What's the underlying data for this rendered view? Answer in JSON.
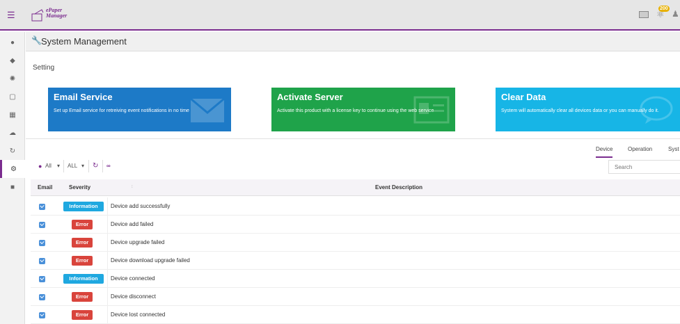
{
  "app": {
    "logo_line1": "ePaper",
    "logo_line2": "Manager",
    "notification_count": "200"
  },
  "header": {
    "title": "System Management"
  },
  "section_label": "Setting",
  "cards": [
    {
      "title": "Email Service",
      "desc": "Set up Email service for retreiving event notifications in no time",
      "color": "#1d7ac7"
    },
    {
      "title": "Activate Server",
      "desc": "Activate this product with a license key to continue using the web service",
      "color": "#1fa34a"
    },
    {
      "title": "Clear Data",
      "desc": "System will automatically clear all devices data or you can manually do it.",
      "color": "#17b5e6"
    }
  ],
  "tabs": [
    "Device",
    "Operation",
    "Syst"
  ],
  "toolbar": {
    "filter_all": "All",
    "filter_all2": "ALL"
  },
  "search": {
    "placeholder": "Search"
  },
  "table": {
    "columns": [
      "Email",
      "Severity",
      "Event Description"
    ],
    "rows": [
      {
        "severity": "Information",
        "desc": "Device add successfully"
      },
      {
        "severity": "Error",
        "desc": "Device add failed"
      },
      {
        "severity": "Error",
        "desc": "Device upgrade failed"
      },
      {
        "severity": "Error",
        "desc": "Device download upgrade failed"
      },
      {
        "severity": "Information",
        "desc": "Device connected"
      },
      {
        "severity": "Error",
        "desc": "Device disconnect"
      },
      {
        "severity": "Error",
        "desc": "Device lost connected"
      }
    ]
  },
  "colors": {
    "accent": "#7b2c8f",
    "info": "#1fa8e0",
    "error": "#d9443c"
  }
}
